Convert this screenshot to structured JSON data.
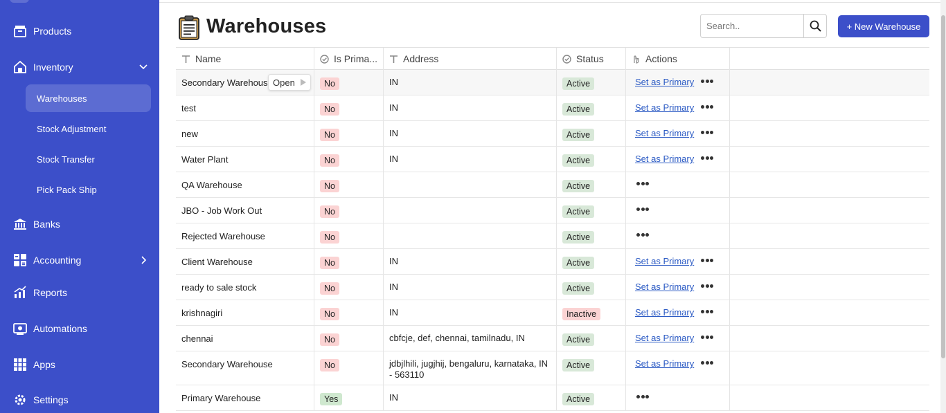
{
  "sidebar": {
    "items": [
      {
        "label": "Products"
      },
      {
        "label": "Inventory"
      },
      {
        "label": "Banks"
      },
      {
        "label": "Accounting"
      },
      {
        "label": "Reports"
      },
      {
        "label": "Automations"
      },
      {
        "label": "Apps"
      },
      {
        "label": "Settings"
      }
    ],
    "inventory_sub": [
      {
        "label": "Warehouses",
        "active": true
      },
      {
        "label": "Stock Adjustment"
      },
      {
        "label": "Stock Transfer"
      },
      {
        "label": "Pick Pack Ship"
      }
    ]
  },
  "header": {
    "title": "Warehouses",
    "search_placeholder": "Search..",
    "new_button": "+ New Warehouse"
  },
  "table": {
    "columns": [
      "Name",
      "Is Prima...",
      "Address",
      "Status",
      "Actions"
    ],
    "open_chip": "Open",
    "set_primary_label": "Set as Primary",
    "rows": [
      {
        "name": "Secondary Warehous",
        "primary": "No",
        "address": "IN",
        "status": "Active",
        "action": "Set as Primary"
      },
      {
        "name": "test",
        "primary": "No",
        "address": "IN",
        "status": "Active",
        "action": "Set as Primary"
      },
      {
        "name": "new",
        "primary": "No",
        "address": "IN",
        "status": "Active",
        "action": "Set as Primary"
      },
      {
        "name": "Water Plant",
        "primary": "No",
        "address": "IN",
        "status": "Active",
        "action": "Set as Primary"
      },
      {
        "name": "QA Warehouse",
        "primary": "No",
        "address": "",
        "status": "Active",
        "action": ""
      },
      {
        "name": "JBO - Job Work Out",
        "primary": "No",
        "address": "",
        "status": "Active",
        "action": ""
      },
      {
        "name": "Rejected Warehouse",
        "primary": "No",
        "address": "",
        "status": "Active",
        "action": ""
      },
      {
        "name": "Client Warehouse",
        "primary": "No",
        "address": "IN",
        "status": "Active",
        "action": "Set as Primary"
      },
      {
        "name": "ready to sale stock",
        "primary": "No",
        "address": "IN",
        "status": "Active",
        "action": "Set as Primary"
      },
      {
        "name": "krishnagiri",
        "primary": "No",
        "address": "IN",
        "status": "Inactive",
        "action": "Set as Primary"
      },
      {
        "name": "chennai",
        "primary": "No",
        "address": "cbfcje, def, chennai, tamilnadu, IN",
        "status": "Active",
        "action": "Set as Primary"
      },
      {
        "name": "Secondary Warehouse",
        "primary": "No",
        "address": "jdbjlhili, jugjhij, bengaluru, karnataka, IN - 563110",
        "status": "Active",
        "action": "Set as Primary"
      },
      {
        "name": "Primary Warehouse",
        "primary": "Yes",
        "address": "IN",
        "status": "Active",
        "action": ""
      }
    ]
  },
  "colors": {
    "sidebar_bg": "#3c4fc9",
    "accent": "#3c4fc9",
    "link": "#2b5ac4",
    "badge_no": "#fbd3d3",
    "badge_yes": "#cfe8cf",
    "badge_active": "#d8e8d8"
  }
}
